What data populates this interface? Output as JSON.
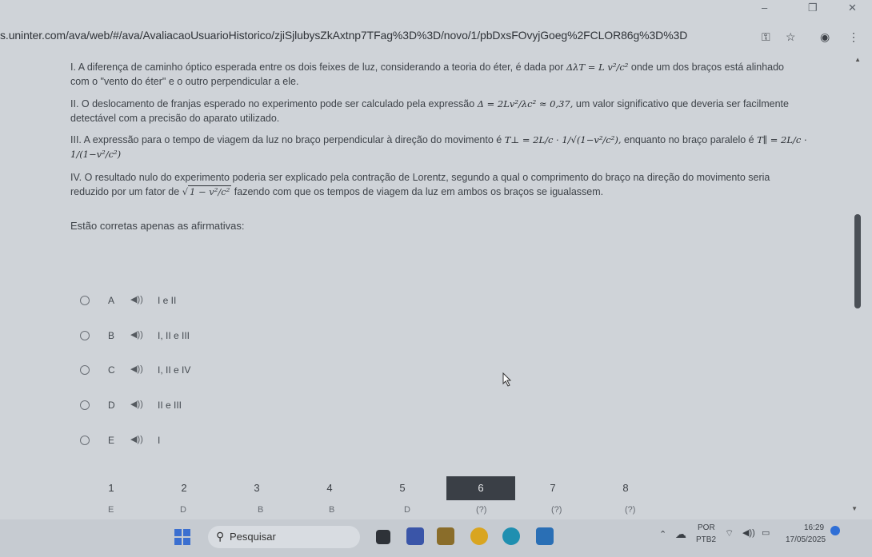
{
  "window": {
    "minimize": "–",
    "restore": "❐",
    "close": "✕"
  },
  "browser": {
    "url": "s.uninter.com/ava/web/#/ava/AvaliacaoUsuarioHistorico/zjiSjlubysZkAxtnp7TFag%3D%3D/novo/1/pbDxsFOvyjGoeg%2FCLOR86g%3D%3D",
    "icons": [
      "key-icon",
      "star-icon",
      "profile-icon",
      "menu-icon"
    ]
  },
  "statements": {
    "s1_pre": "I. A diferença de caminho óptico esperada entre os dois feixes de luz, considerando a teoria do éter, é dada por",
    "s1_math": "ΔλT = L v²/c²",
    "s1_post": "onde um dos braços está alinhado",
    "s1_line2": "com o \"vento do éter\" e o outro perpendicular a ele.",
    "s2_pre": "II. O deslocamento de franjas esperado no experimento pode ser calculado pela expressão",
    "s2_math": "Δ = 2Lv²/λc² ≈ 0,37,",
    "s2_post": "um valor significativo que deveria ser facilmente",
    "s2_line2": "detectável com a precisão do aparato utilizado.",
    "s3_pre": "III. A expressão para o tempo de viagem da luz no braço perpendicular à direção do movimento é",
    "s3_math1": "T⊥ = 2L/c · 1/√(1−v²/c²),",
    "s3_mid": "enquanto no braço paralelo é",
    "s3_math2": "T∥ = 2L/c · 1/(1−v²/c²)",
    "s4_pre": "IV. O resultado nulo do experimento poderia ser explicado pela contração de Lorentz, segundo a qual o comprimento do braço na direção do movimento seria",
    "s4_line2_pre": "reduzido por um fator de",
    "s4_math": "1 − v²/c²",
    "s4_line2_post": "fazendo com que os tempos de viagem da luz em ambos os braços se igualassem."
  },
  "question": "Estão corretas apenas as afirmativas:",
  "options": [
    {
      "letter": "A",
      "text": "I e II"
    },
    {
      "letter": "B",
      "text": "I, II e III"
    },
    {
      "letter": "C",
      "text": "I, II e IV"
    },
    {
      "letter": "D",
      "text": "II e III"
    },
    {
      "letter": "E",
      "text": "I"
    }
  ],
  "speaker_glyph": "◀))",
  "pager": {
    "pages": [
      "1",
      "2",
      "3",
      "4",
      "5",
      "6",
      "7",
      "8"
    ],
    "active": "6",
    "sublabels": [
      "E",
      "D",
      "B",
      "B",
      "D",
      "(?)",
      "(?)",
      "(?)"
    ]
  },
  "taskbar": {
    "search_label": "Pesquisar",
    "lang_top": "POR",
    "lang_bottom": "PTB2",
    "time": "16:29",
    "date": "17/05/2025"
  }
}
